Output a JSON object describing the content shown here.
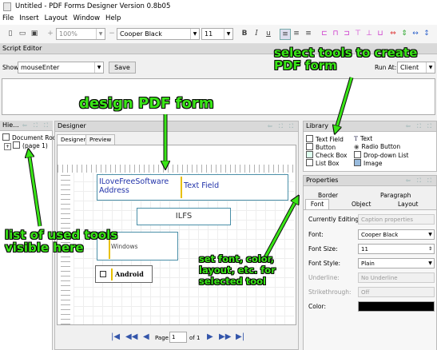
{
  "window": {
    "title": "Untitled - PDF Forms Designer Version 0.8b05"
  },
  "menu": [
    "File",
    "Insert",
    "Layout",
    "Window",
    "Help"
  ],
  "toolbar": {
    "zoom": "100%",
    "font": "Cooper Black",
    "font_size": "11",
    "bold": "B",
    "italic": "I",
    "underline": "u"
  },
  "script_editor": {
    "title": "Script Editor",
    "show_label": "Show:",
    "show_value": "mouseEnter",
    "save_label": "Save",
    "run_at_label": "Run At:",
    "run_at_value": "Client"
  },
  "hierarchy": {
    "title": "Hie...",
    "root": "Document Root",
    "page": "(page 1)"
  },
  "designer": {
    "title": "Designer",
    "tabs": [
      "Designer",
      "Preview"
    ],
    "field1_caption": "ILoveFreeSoftware Address",
    "field1_text": "Text Field",
    "field2_text": "ILFS",
    "field3_text": "Windows",
    "field4_text": "Android",
    "page_label": "Page",
    "page_value": "1",
    "page_of": "of 1"
  },
  "library": {
    "title": "Library",
    "items_left": [
      "Text Field",
      "Button",
      "Check Box",
      "List Box"
    ],
    "items_right": [
      "Text",
      "Radio Button",
      "Drop-down List",
      "Image"
    ]
  },
  "properties": {
    "title": "Properties",
    "tabs_top": [
      "Border",
      "Paragraph"
    ],
    "tabs_bottom": [
      "Font",
      "Object",
      "Layout"
    ],
    "currently_editing_label": "Currently Editing:",
    "currently_editing_value": "Caption properties",
    "font_label": "Font:",
    "font_value": "Cooper Black",
    "font_size_label": "Font Size:",
    "font_size_value": "11",
    "font_style_label": "Font Style:",
    "font_style_value": "Plain",
    "underline_label": "Underline:",
    "underline_value": "No Underline",
    "strikethrough_label": "Strikethrough:",
    "strikethrough_value": "Off",
    "color_label": "Color:"
  },
  "annotations": {
    "select_tools": "select tools to create PDF form",
    "design": "design PDF form",
    "list_tools": "list of used tools visible here",
    "set_font": "set font, color, layout, etc. for selected tool"
  },
  "colors": {
    "annotation_green": "#39e616",
    "field_border": "#4a8fa8",
    "field_text": "#2233aa",
    "active_field": "#e8c000"
  }
}
